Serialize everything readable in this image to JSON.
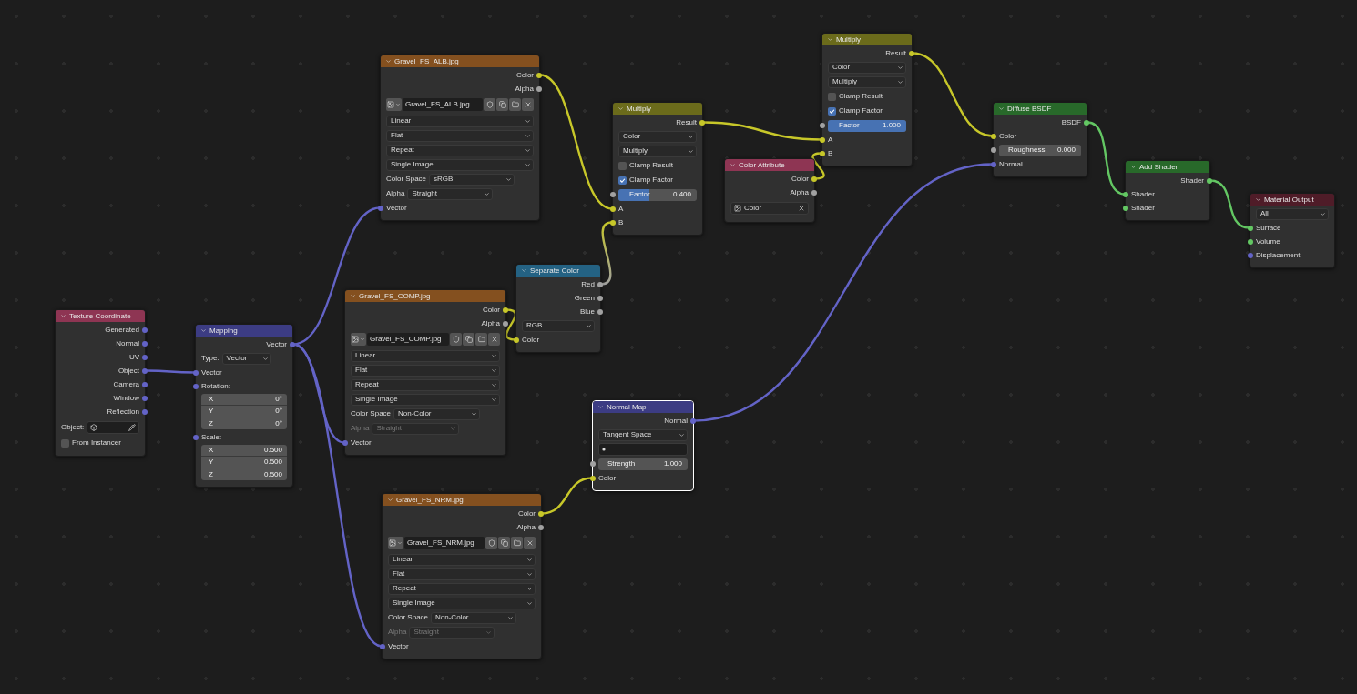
{
  "nodes": [
    {
      "title": "Texture Coordinate",
      "color": "#8e3553",
      "selected": false,
      "rows": [
        {
          "kind": "output",
          "label": "Generated",
          "color": "#6363c7"
        },
        {
          "kind": "output",
          "label": "Normal",
          "color": "#6363c7"
        },
        {
          "kind": "output",
          "label": "UV",
          "color": "#6363c7"
        },
        {
          "kind": "output",
          "label": "Object",
          "color": "#6363c7"
        },
        {
          "kind": "output",
          "label": "Camera",
          "color": "#6363c7"
        },
        {
          "kind": "output",
          "label": "Window",
          "color": "#6363c7"
        },
        {
          "kind": "output",
          "label": "Reflection",
          "color": "#6363c7"
        },
        {
          "kind": "field",
          "label": "Object:"
        },
        {
          "kind": "checkbox",
          "label": "From Instancer",
          "checked": false
        }
      ]
    },
    {
      "title": "Mapping",
      "color": "#3c3c83",
      "selected": false,
      "rows": [
        {
          "kind": "output",
          "label": "Vector",
          "color": "#6363c7"
        },
        {
          "kind": "labeled",
          "label": "Type:",
          "value": "Vector",
          "disabled": false
        },
        {
          "kind": "input",
          "label": "Vector",
          "color": "#6363c7"
        },
        {
          "kind": "input",
          "label": "Rotation:",
          "color": "#6363c7"
        },
        {
          "kind": "vector",
          "values": [
            {
              "label": "X",
              "value": "0°"
            },
            {
              "label": "Y",
              "value": "0°"
            },
            {
              "label": "Z",
              "value": "0°"
            }
          ]
        },
        {
          "kind": "input",
          "label": "Scale:",
          "color": "#6363c7"
        },
        {
          "kind": "vector",
          "values": [
            {
              "label": "X",
              "value": "0.500"
            },
            {
              "label": "Y",
              "value": "0.500"
            },
            {
              "label": "Z",
              "value": "0.500"
            }
          ]
        }
      ]
    },
    {
      "title": "Gravel_FS_ALB.jpg",
      "color": "#84501f",
      "selected": false,
      "rows": [
        {
          "kind": "output",
          "label": "Color",
          "color": "#c7c729"
        },
        {
          "kind": "output",
          "label": "Alpha",
          "color": "#a1a1a1"
        },
        {
          "kind": "image",
          "value": "Gravel_FS_ALB.jpg"
        },
        {
          "kind": "dropdown",
          "value": "Linear"
        },
        {
          "kind": "dropdown",
          "value": "Flat"
        },
        {
          "kind": "dropdown",
          "value": "Repeat"
        },
        {
          "kind": "dropdown",
          "value": "Single Image"
        },
        {
          "kind": "labeled",
          "label": "Color Space",
          "value": "sRGB",
          "disabled": false
        },
        {
          "kind": "labeled",
          "label": "Alpha",
          "value": "Straight",
          "disabled": false
        },
        {
          "kind": "input",
          "label": "Vector",
          "color": "#6363c7"
        }
      ]
    },
    {
      "title": "Gravel_FS_COMP.jpg",
      "color": "#84501f",
      "selected": false,
      "rows": [
        {
          "kind": "output",
          "label": "Color",
          "color": "#c7c729"
        },
        {
          "kind": "output",
          "label": "Alpha",
          "color": "#a1a1a1"
        },
        {
          "kind": "image",
          "value": "Gravel_FS_COMP.jpg"
        },
        {
          "kind": "dropdown",
          "value": "Linear"
        },
        {
          "kind": "dropdown",
          "value": "Flat"
        },
        {
          "kind": "dropdown",
          "value": "Repeat"
        },
        {
          "kind": "dropdown",
          "value": "Single Image"
        },
        {
          "kind": "labeled",
          "label": "Color Space",
          "value": "Non-Color",
          "disabled": false
        },
        {
          "kind": "labeled",
          "label": "Alpha",
          "value": "Straight",
          "disabled": true
        },
        {
          "kind": "input",
          "label": "Vector",
          "color": "#6363c7"
        }
      ]
    },
    {
      "title": "Gravel_FS_NRM.jpg",
      "color": "#84501f",
      "selected": false,
      "rows": [
        {
          "kind": "output",
          "label": "Color",
          "color": "#c7c729"
        },
        {
          "kind": "output",
          "label": "Alpha",
          "color": "#a1a1a1"
        },
        {
          "kind": "image",
          "value": "Gravel_FS_NRM.jpg"
        },
        {
          "kind": "dropdown",
          "value": "Linear"
        },
        {
          "kind": "dropdown",
          "value": "Flat"
        },
        {
          "kind": "dropdown",
          "value": "Repeat"
        },
        {
          "kind": "dropdown",
          "value": "Single Image"
        },
        {
          "kind": "labeled",
          "label": "Color Space",
          "value": "Non-Color",
          "disabled": false
        },
        {
          "kind": "labeled",
          "label": "Alpha",
          "value": "Straight",
          "disabled": true
        },
        {
          "kind": "input",
          "label": "Vector",
          "color": "#6363c7"
        }
      ]
    },
    {
      "title": "Separate Color",
      "color": "#246283",
      "selected": false,
      "rows": [
        {
          "kind": "output",
          "label": "Red",
          "color": "#a1a1a1"
        },
        {
          "kind": "output",
          "label": "Green",
          "color": "#a1a1a1"
        },
        {
          "kind": "output",
          "label": "Blue",
          "color": "#a1a1a1"
        },
        {
          "kind": "dropdown",
          "value": "RGB"
        },
        {
          "kind": "input",
          "label": "Color",
          "color": "#c7c729"
        }
      ]
    },
    {
      "title": "Multiply",
      "color": "#6b6b1b",
      "selected": false,
      "rows": [
        {
          "kind": "output",
          "label": "Result",
          "color": "#c7c729"
        },
        {
          "kind": "dropdown",
          "value": "Color"
        },
        {
          "kind": "dropdown",
          "value": "Multiply"
        },
        {
          "kind": "checkbox",
          "label": "Clamp Result",
          "checked": false
        },
        {
          "kind": "checkbox",
          "label": "Clamp Factor",
          "checked": true
        },
        {
          "kind": "slider",
          "label": "Factor",
          "value": "0.400",
          "level": 0.4,
          "color": "#a1a1a1"
        },
        {
          "kind": "input",
          "label": "A",
          "color": "#c7c729"
        },
        {
          "kind": "input",
          "label": "B",
          "color": "#c7c729"
        }
      ]
    },
    {
      "title": "Color Attribute",
      "color": "#8e3553",
      "selected": false,
      "rows": [
        {
          "kind": "output",
          "label": "Color",
          "color": "#c7c729"
        },
        {
          "kind": "output",
          "label": "Alpha",
          "color": "#a1a1a1"
        },
        {
          "kind": "attribute",
          "value": "Color"
        }
      ]
    },
    {
      "title": "Multiply",
      "color": "#6b6b1b",
      "selected": false,
      "rows": [
        {
          "kind": "output",
          "label": "Result",
          "color": "#c7c729"
        },
        {
          "kind": "dropdown",
          "value": "Color"
        },
        {
          "kind": "dropdown",
          "value": "Multiply"
        },
        {
          "kind": "checkbox",
          "label": "Clamp Result",
          "checked": false
        },
        {
          "kind": "checkbox",
          "label": "Clamp Factor",
          "checked": true
        },
        {
          "kind": "slider",
          "label": "Factor",
          "value": "1.000",
          "level": 1,
          "color": "#a1a1a1"
        },
        {
          "kind": "input",
          "label": "A",
          "color": "#c7c729"
        },
        {
          "kind": "input",
          "label": "B",
          "color": "#c7c729"
        }
      ]
    },
    {
      "title": "Diffuse BSDF",
      "color": "#28692a",
      "selected": false,
      "rows": [
        {
          "kind": "output",
          "label": "BSDF",
          "color": "#63c763"
        },
        {
          "kind": "input",
          "label": "Color",
          "color": "#c7c729"
        },
        {
          "kind": "number",
          "label": "Roughness",
          "value": "0.000",
          "color": "#a1a1a1"
        },
        {
          "kind": "input",
          "label": "Normal",
          "color": "#6363c7"
        }
      ]
    },
    {
      "title": "Add Shader",
      "color": "#28692a",
      "selected": false,
      "rows": [
        {
          "kind": "output",
          "label": "Shader",
          "color": "#63c763"
        },
        {
          "kind": "input",
          "label": "Shader",
          "color": "#63c763"
        },
        {
          "kind": "input",
          "label": "Shader",
          "color": "#63c763"
        }
      ]
    },
    {
      "title": "Material Output",
      "color": "#4f1c28",
      "selected": false,
      "rows": [
        {
          "kind": "dropdown",
          "value": "All"
        },
        {
          "kind": "input",
          "label": "Surface",
          "color": "#63c763"
        },
        {
          "kind": "input",
          "label": "Volume",
          "color": "#63c763"
        },
        {
          "kind": "input",
          "label": "Displacement",
          "color": "#6363c7"
        }
      ]
    },
    {
      "title": "Normal Map",
      "color": "#3c3c83",
      "selected": true,
      "rows": [
        {
          "kind": "output",
          "label": "Normal",
          "color": "#6363c7"
        },
        {
          "kind": "dropdown",
          "value": "Tangent Space"
        },
        {
          "kind": "uvfield"
        },
        {
          "kind": "number",
          "label": "Strength",
          "value": "1.000",
          "color": "#a1a1a1"
        },
        {
          "kind": "input",
          "label": "Color",
          "color": "#c7c729"
        }
      ]
    }
  ]
}
